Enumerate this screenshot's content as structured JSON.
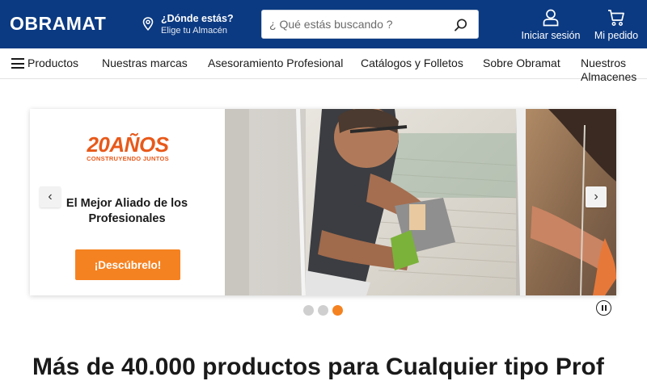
{
  "header": {
    "logo": "OBRAMAT",
    "location_title": "¿Dónde estás?",
    "location_subtitle": "Elige tu Almacén",
    "search_placeholder": "¿ Qué estás buscando ?",
    "login_label": "Iniciar sesión",
    "order_label": "Mi pedido",
    "bg_color": "#0b3a82"
  },
  "nav": {
    "items": [
      {
        "label": "Productos",
        "icon": "menu-icon"
      },
      {
        "label": "Nuestras marcas"
      },
      {
        "label": "Asesoramiento Profesional"
      },
      {
        "label": "Catálogos y Folletos"
      },
      {
        "label": "Sobre Obramat"
      },
      {
        "label": "Nuestros Almacenes"
      }
    ]
  },
  "banner": {
    "badge_number": "20",
    "badge_word": "AÑOS",
    "badge_tagline": "CONSTRUYENDO JUNTOS",
    "title": "El Mejor Aliado de los Profesionales",
    "cta_label": "¡Descúbrelo!",
    "accent_color": "#f58220",
    "slide_count": 3,
    "active_slide": 3
  },
  "section_heading": "Más de 40.000 productos para Cualquier tipo Prof"
}
